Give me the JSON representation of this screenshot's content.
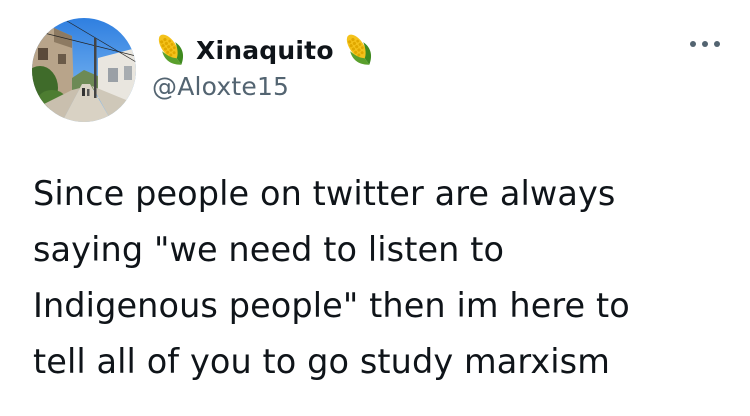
{
  "tweet": {
    "author": {
      "display_name": "Xinaquito",
      "handle": "@Aloxte15",
      "name_emoji_left": "corn-icon",
      "name_emoji_right": "corn-icon",
      "avatar": "street-photo-avatar"
    },
    "more_icon": "more-horizontal-icon",
    "text_lines": [
      "Since people on twitter are always",
      "saying \"we need to listen to",
      "Indigenous people\" then im here to",
      "tell all of you to go study marxism"
    ]
  },
  "colors": {
    "text_primary": "#0f1419",
    "text_secondary": "#536471",
    "background": "#ffffff"
  }
}
